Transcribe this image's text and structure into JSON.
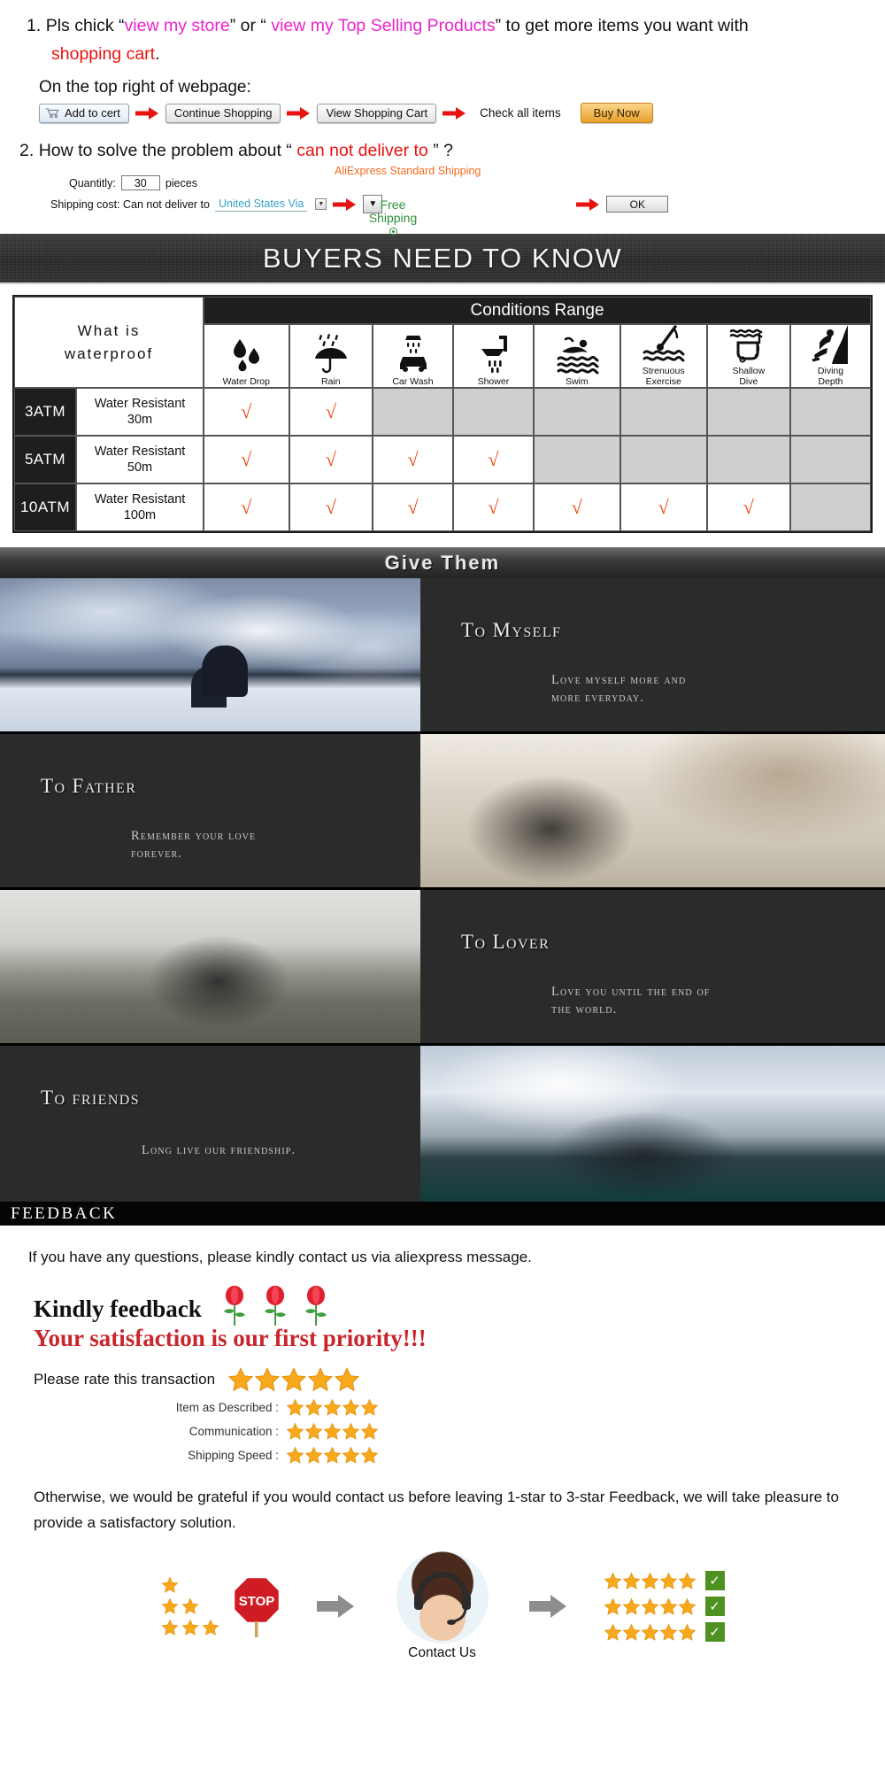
{
  "instructions": {
    "item1": {
      "num": "1.",
      "pre": "Pls chick “",
      "link1": "view my store",
      "mid": "” or “ ",
      "link2": "view my Top Selling  Products",
      "post": "” to get more items you want with",
      "line2": "shopping cart",
      "line2_dot": ".",
      "subhead": "On the top right of webpage:",
      "flow": {
        "add_to_cart": "Add to cert",
        "continue_shopping": "Continue Shopping",
        "view_cart": "View Shopping Cart",
        "check_all": "Check all items",
        "buy_now": "Buy Now"
      }
    },
    "item2": {
      "num": "2.",
      "pre": "How to solve the problem about “ ",
      "highlight": "can not deliver to",
      "post": " ” ?",
      "quantity_label": "Quantitly:",
      "quantity_value": "30",
      "pieces": "pieces",
      "shipping_label": "Shipping cost: Can not deliver to",
      "country": "United States Via",
      "carrier": "AliExpress Standard Shipping",
      "free_shipping_l1": "Free",
      "free_shipping_l2": "Shipping",
      "ok": "OK"
    }
  },
  "buyers_banner": {
    "title": "BUYERS NEED TO KNOW"
  },
  "waterproof": {
    "left_title_l1": "What is",
    "left_title_l2": "waterproof",
    "conditions_header": "Conditions Range",
    "columns": [
      {
        "label": "Water Drop",
        "icon": "water-drop-icon"
      },
      {
        "label": "Rain",
        "icon": "umbrella-rain-icon"
      },
      {
        "label": "Car Wash",
        "icon": "car-wash-icon"
      },
      {
        "label": "Shower",
        "icon": "shower-icon"
      },
      {
        "label": "Swim",
        "icon": "swimmer-icon"
      },
      {
        "label": "Strenuous\nExercise",
        "label_l1": "Strenuous",
        "label_l2": "Exercise",
        "icon": "strenuous-exercise-icon"
      },
      {
        "label_l1": "Shallow",
        "label_l2": "Dive",
        "icon": "shallow-dive-icon"
      },
      {
        "label_l1": "Diving",
        "label_l2": "Depth",
        "icon": "diving-depth-icon"
      }
    ],
    "rows": [
      {
        "atm": "3ATM",
        "desc_l1": "Water Resistant",
        "desc_l2": "30m",
        "marks": [
          true,
          true,
          false,
          false,
          false,
          false,
          false,
          false
        ]
      },
      {
        "atm": "5ATM",
        "desc_l1": "Water Resistant",
        "desc_l2": "50m",
        "marks": [
          true,
          true,
          true,
          true,
          false,
          false,
          false,
          false
        ]
      },
      {
        "atm": "10ATM",
        "desc_l1": "Water Resistant",
        "desc_l2": "100m",
        "marks": [
          true,
          true,
          true,
          true,
          true,
          true,
          true,
          false
        ]
      }
    ],
    "tick_glyph": "√",
    "tick_color": "#ef4a12"
  },
  "give_them": {
    "title": "Give Them",
    "panels": [
      {
        "title": "To Myself",
        "sub_l1": "Love myself more and",
        "sub_l2": "more everyday."
      },
      {
        "title": "To Father",
        "sub_l1": "Remember your love",
        "sub_l2": "forever."
      },
      {
        "title": "To Lover",
        "sub_l1": "Love you until the end of",
        "sub_l2": "the world."
      },
      {
        "title": "To friends",
        "sub_l1": "Long live our friendship.",
        "sub_l2": ""
      }
    ]
  },
  "feedback": {
    "banner": "FEEDBACK",
    "contact_line": "If you have any questions, please kindly contact us via aliexpress message.",
    "kindly": "Kindly feedback",
    "satisfaction": "Your satisfaction is our first priority!!!",
    "rate_label": "Please rate this transaction",
    "rate_stars": 5,
    "sub_ratings": [
      {
        "label": "Item as Described :",
        "stars": 5
      },
      {
        "label": "Communication :",
        "stars": 5
      },
      {
        "label": "Shipping Speed :",
        "stars": 5
      }
    ],
    "note": "Otherwise, we would be grateful if you would contact us before leaving 1-star to 3-star Feedback, we will take pleasure to provide a satisfactory solution.",
    "stop_text": "STOP",
    "contact_us": "Contact Us",
    "good_rows": [
      5,
      5,
      5
    ],
    "check_glyph": "✓"
  },
  "colors": {
    "magenta": "#ee22cc",
    "red": "#e8130f",
    "orange_tick": "#ef4a12",
    "carrier_orange": "#f26c20",
    "free_green": "#2f8f3e",
    "country_blue": "#3aa0c8",
    "satisfaction_red": "#c8262c",
    "green_check": "#4f9121",
    "dark_banner": "#2a2a2a"
  }
}
